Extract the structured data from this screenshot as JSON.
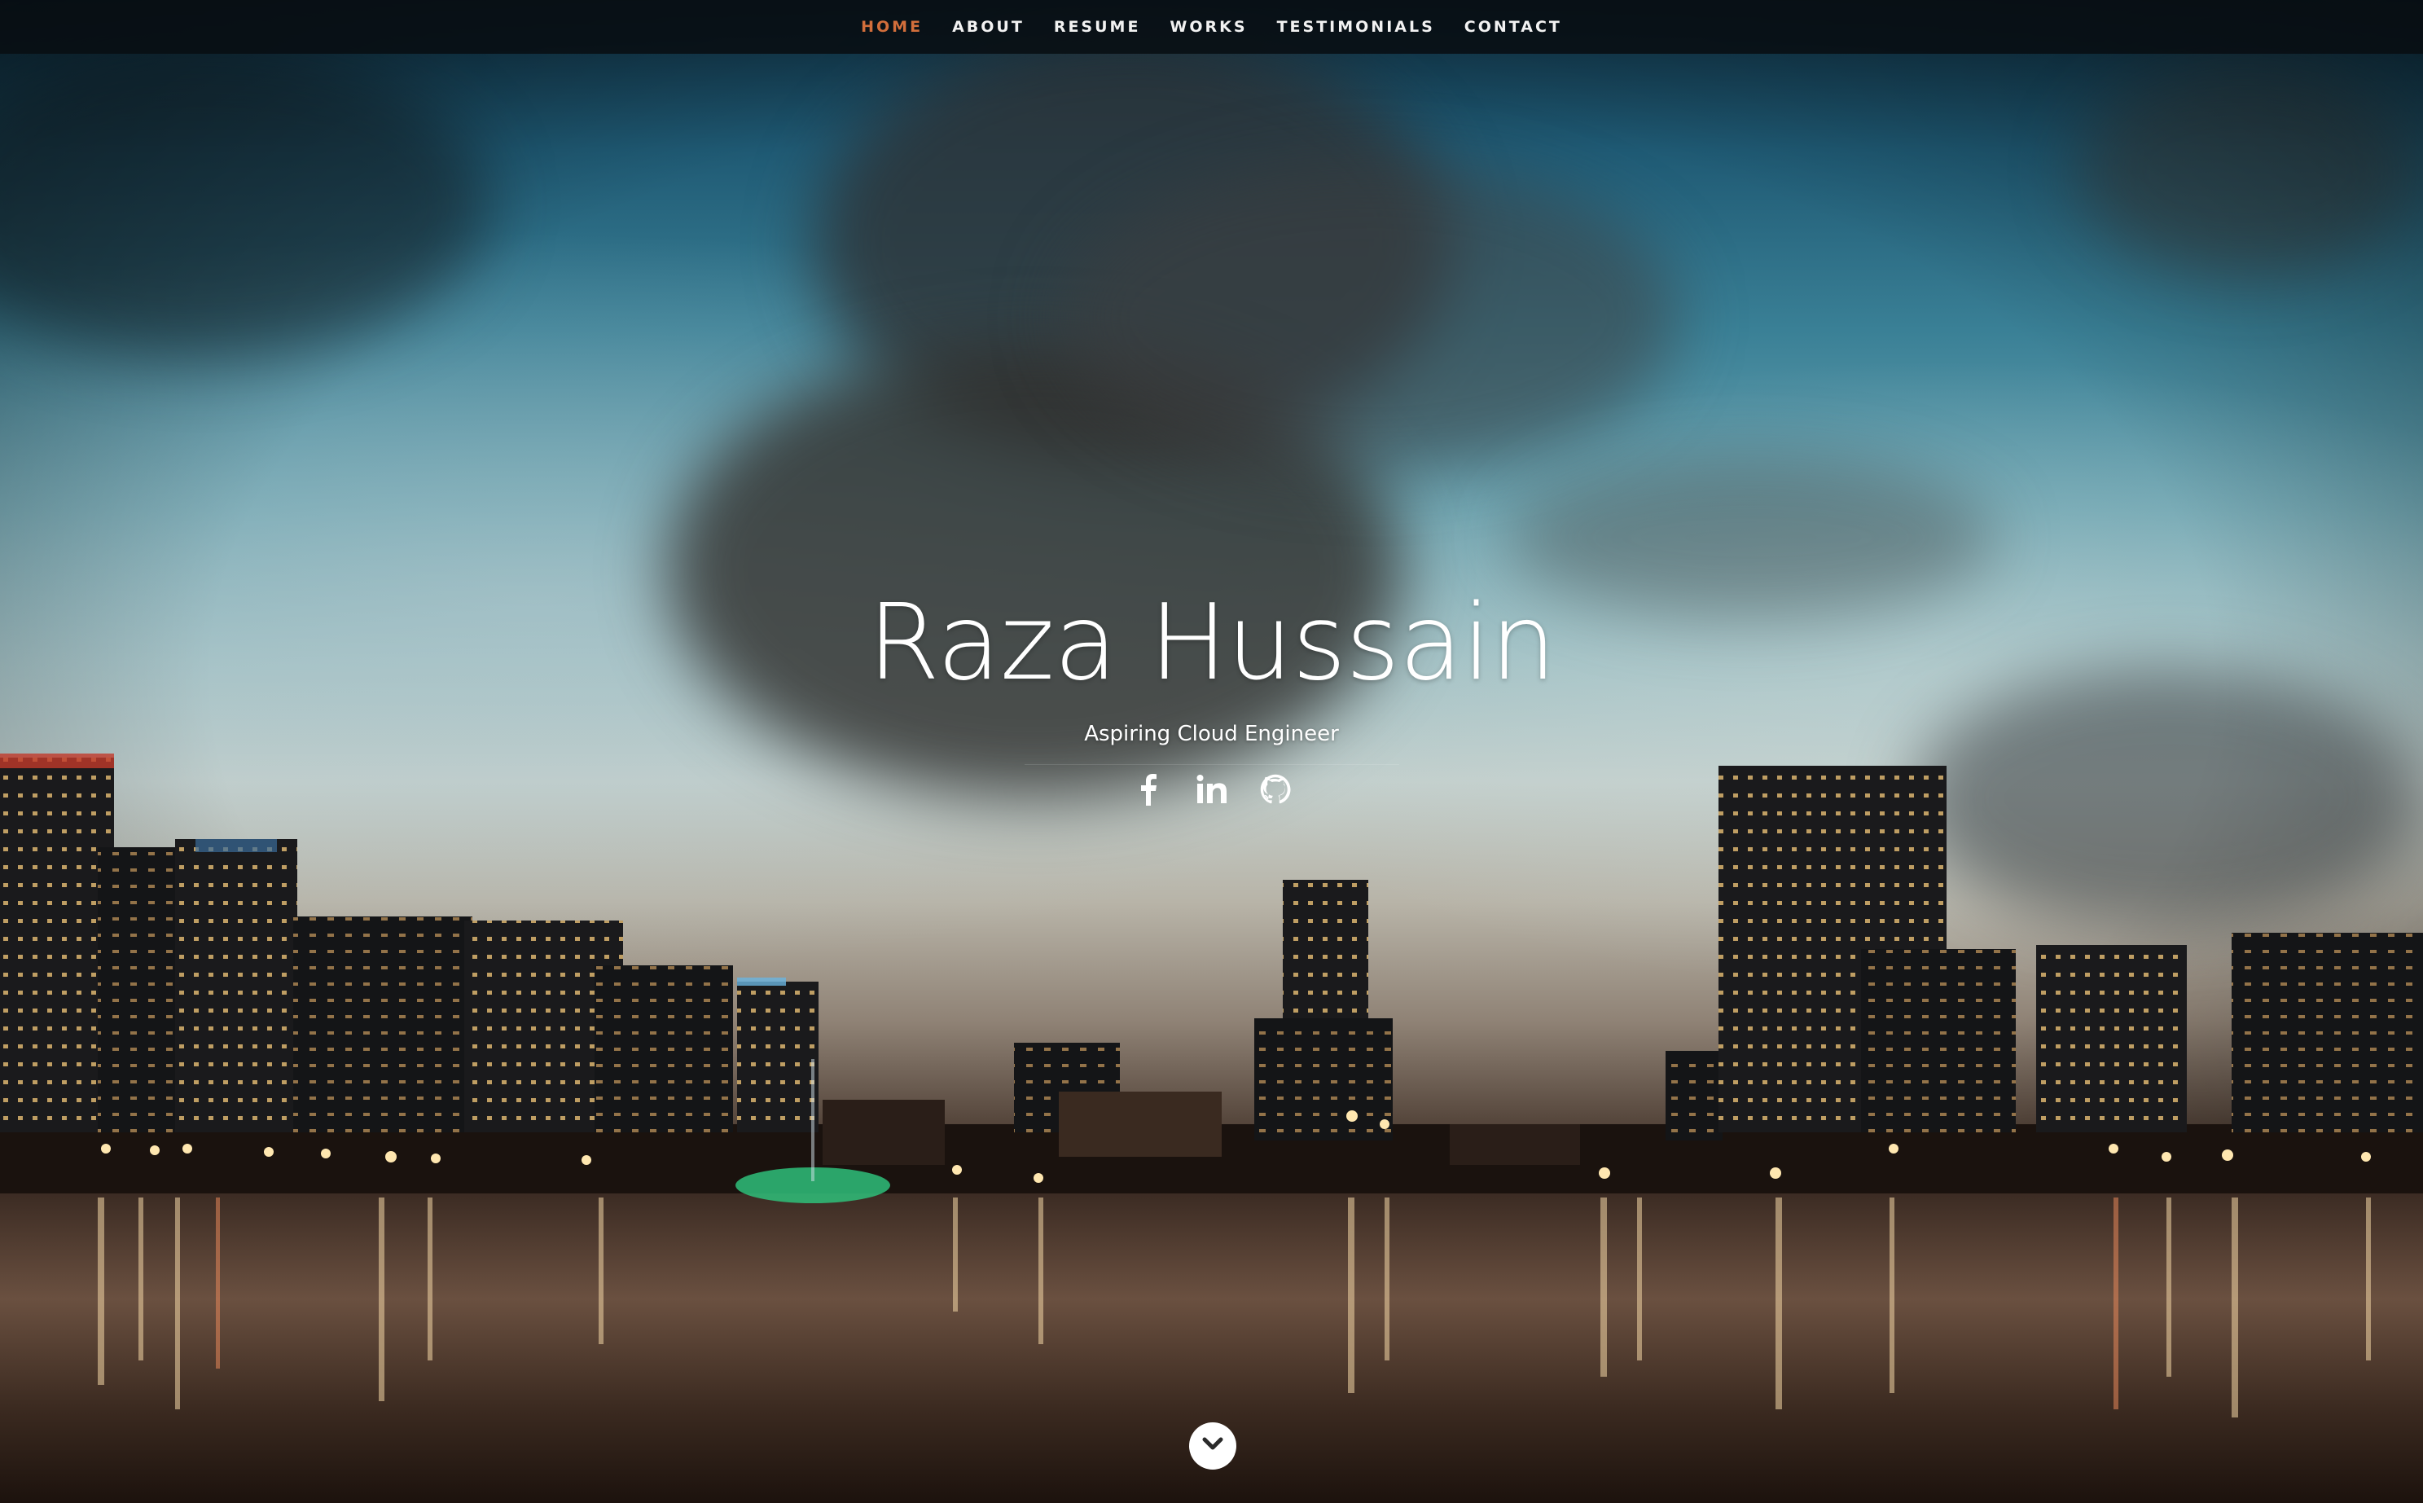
{
  "nav": {
    "items": [
      {
        "label": "HOME",
        "current": true
      },
      {
        "label": "ABOUT",
        "current": false
      },
      {
        "label": "RESUME",
        "current": false
      },
      {
        "label": "WORKS",
        "current": false
      },
      {
        "label": "TESTIMONIALS",
        "current": false
      },
      {
        "label": "CONTACT",
        "current": false
      }
    ],
    "active_color": "#d26e3b"
  },
  "banner": {
    "name": "Raza Hussain",
    "subtitle": "Aspiring Cloud Engineer"
  },
  "social": [
    {
      "icon": "facebook-icon"
    },
    {
      "icon": "linkedin-icon"
    },
    {
      "icon": "github-icon"
    }
  ],
  "scroll_down": {
    "icon": "chevron-down-icon"
  }
}
